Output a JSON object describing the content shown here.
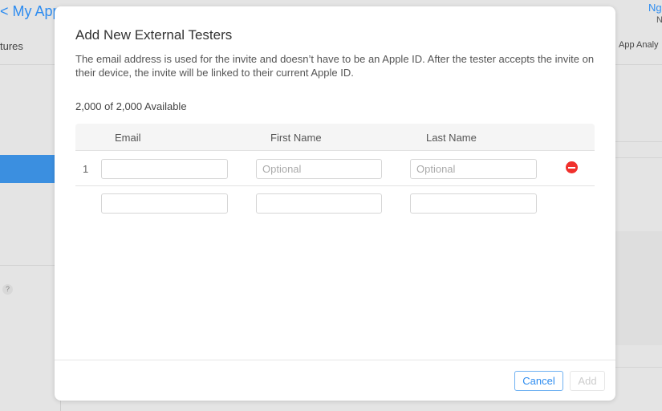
{
  "background": {
    "back_label": "< My App",
    "user_name": "Ng",
    "user_sub": "N",
    "nav_left": "tures",
    "nav_right": "App Analy",
    "help": "?"
  },
  "modal": {
    "title": "Add New External Testers",
    "description": "The email address is used for the invite and doesn’t have to be an Apple ID. After the tester accepts the invite on their device, the invite will be linked to their current Apple ID.",
    "available": "2,000 of 2,000 Available",
    "columns": [
      "Email",
      "First Name",
      "Last Name"
    ],
    "rows": [
      {
        "number": "1",
        "email": "",
        "first_name": "",
        "last_name": "",
        "first_placeholder": "Optional",
        "last_placeholder": "Optional"
      },
      {
        "number": "",
        "email": "",
        "first_name": "",
        "last_name": ""
      }
    ],
    "cancel_label": "Cancel",
    "add_label": "Add"
  },
  "colors": {
    "accent": "#2d8cf0",
    "remove": "#f0302c",
    "selected": "#3b8fe0"
  }
}
